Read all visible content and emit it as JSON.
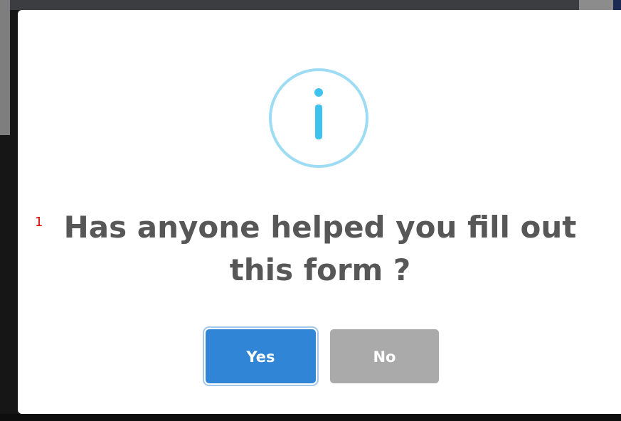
{
  "dialog": {
    "icon": "info-icon",
    "line_number": "1",
    "question_line1": "Has anyone helped you fill out",
    "question_line2": "this form ?",
    "yes_label": "Yes",
    "no_label": "No"
  },
  "colors": {
    "confirm_button": "#3085d6",
    "cancel_button": "#aaaaaa",
    "icon_ring": "#9ddcf3",
    "icon_glyph": "#3fc3ee",
    "question_text": "#575757",
    "line_number": "#e00000"
  }
}
